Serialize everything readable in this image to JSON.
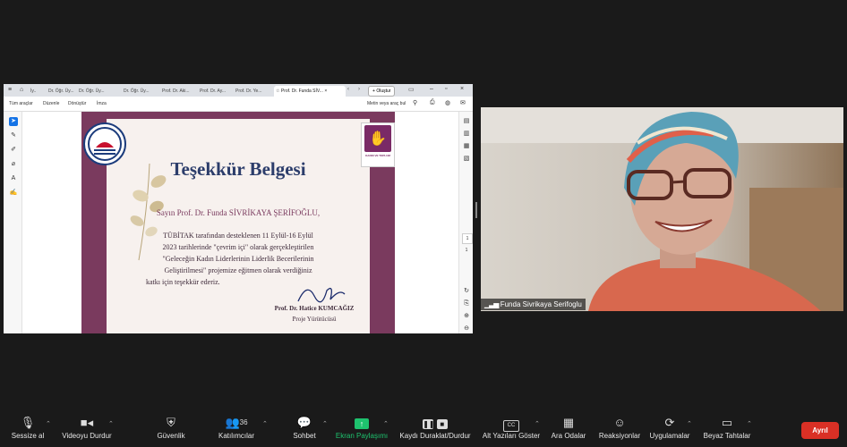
{
  "browser": {
    "tabs": [
      "Dr. Öğr. Üy...",
      "Dr. Öğr. Üy...",
      "Dr. Öğr. Üy...",
      "Prof. Dr. Aki...",
      "Prof. Dr. Ay...",
      "Prof. Dr. Ye..."
    ],
    "active_tab": "Prof. Dr. Funda SİV...",
    "new_tab": "Oluştur"
  },
  "pdf_toolbar": {
    "all_tools": "Tüm araçlar",
    "edit": "Düzenle",
    "convert": "Dönüştür",
    "sign": "İmza",
    "search_placeholder": "Metin veya araç bul"
  },
  "certificate": {
    "title": "Teşekkür Belgesi",
    "recipient": "Sayın Prof. Dr. Funda SİVRİKAYA ŞERİFOĞLU,",
    "body_lines": [
      "TÜBİTAK tarafından desteklenen 11 Eylül-16 Eylül",
      "2023 tarihlerinde \"çevrim içi\" olarak gerçekleştirilen",
      "\"Geleceğin Kadın Liderlerinin Liderlik Becerilerinin",
      "Geliştirilmesi\" projemize eğitmen olarak verdiğiniz",
      "katkı için teşekkür ederiz."
    ],
    "signer": "Prof. Dr. Hatice KUMCAĞIZ",
    "signer_role": "Proje Yürütücüsü",
    "logo_right_text": "KADIN VE TOPLUM"
  },
  "video": {
    "participant_name": "Funda Sivrikaya Serifoglu"
  },
  "bottom_bar": {
    "mute": "Sessize al",
    "stop_video": "Videoyu Durdur",
    "security": "Güvenlik",
    "participants": "Katılımcılar",
    "participants_count": "36",
    "chat": "Sohbet",
    "share_screen": "Ekran Paylaşımı",
    "record": "Kaydı Duraklat/Durdur",
    "captions": "Alt Yazıları Göster",
    "breakout": "Ara Odalar",
    "reactions": "Reaksiyonlar",
    "apps": "Uygulamalar",
    "whiteboards": "Beyaz Tahtalar",
    "leave": "Ayrıl",
    "share_color": "#1ec26e",
    "leave_color": "#d93025"
  }
}
